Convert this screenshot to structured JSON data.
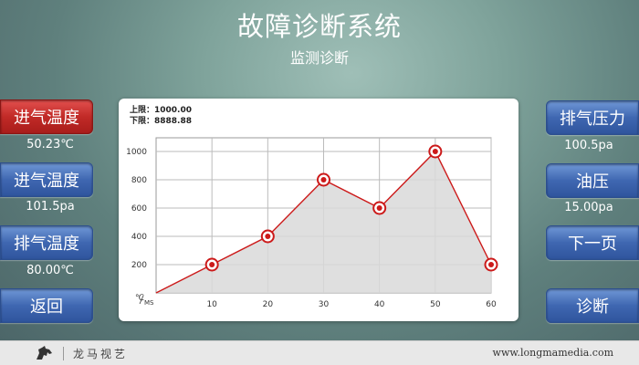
{
  "header": {
    "title": "故障诊断系统",
    "subtitle": "监测诊断"
  },
  "left_buttons": [
    {
      "label": "进气温度",
      "value": "50.23℃",
      "active": true
    },
    {
      "label": "进气温度",
      "value": "101.5pa",
      "active": false
    },
    {
      "label": "排气温度",
      "value": "80.00℃",
      "active": false
    },
    {
      "label": "返回"
    }
  ],
  "right_buttons": [
    {
      "label": "排气压力",
      "value": "100.5pa"
    },
    {
      "label": "油压",
      "value": "15.00pa"
    },
    {
      "label": "下一页"
    },
    {
      "label": "诊断"
    }
  ],
  "limits": {
    "upper": "上限：1000.00",
    "lower": "下限：8888.88"
  },
  "chart_data": {
    "type": "area",
    "x": [
      0,
      10,
      20,
      30,
      40,
      50,
      60
    ],
    "values": [
      0,
      200,
      400,
      800,
      600,
      1000,
      200
    ],
    "xticks": [
      "10",
      "20",
      "30",
      "40",
      "50",
      "60"
    ],
    "yticks": [
      "200",
      "400",
      "600",
      "800",
      "1000"
    ],
    "xlim": [
      0,
      60
    ],
    "ylim": [
      0,
      1000
    ],
    "axis_unit_y": "℃",
    "axis_unit_x": "MS",
    "grid": true,
    "line_color": "#cc1a1a",
    "fill_color": "#d9d9d9"
  },
  "footer": {
    "brand": "龙马视艺",
    "website": "www.longmamedia.com"
  },
  "colors": {
    "active_button": "#c12a27",
    "button": "#3f67b1"
  }
}
